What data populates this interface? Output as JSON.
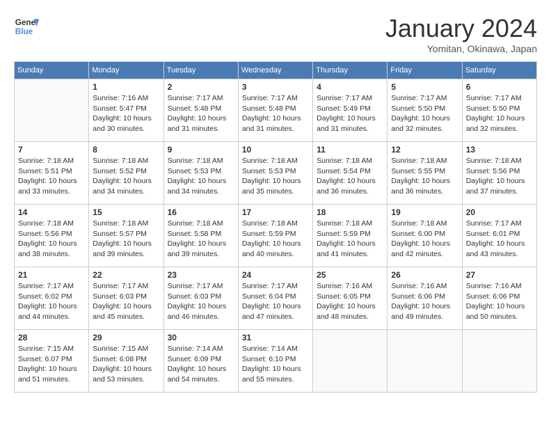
{
  "header": {
    "logo_line1": "General",
    "logo_line2": "Blue",
    "month_title": "January 2024",
    "subtitle": "Yomitan, Okinawa, Japan"
  },
  "days_of_week": [
    "Sunday",
    "Monday",
    "Tuesday",
    "Wednesday",
    "Thursday",
    "Friday",
    "Saturday"
  ],
  "weeks": [
    [
      {
        "day": null,
        "info": null
      },
      {
        "day": "1",
        "info": "Sunrise: 7:16 AM\nSunset: 5:47 PM\nDaylight: 10 hours\nand 30 minutes."
      },
      {
        "day": "2",
        "info": "Sunrise: 7:17 AM\nSunset: 5:48 PM\nDaylight: 10 hours\nand 31 minutes."
      },
      {
        "day": "3",
        "info": "Sunrise: 7:17 AM\nSunset: 5:48 PM\nDaylight: 10 hours\nand 31 minutes."
      },
      {
        "day": "4",
        "info": "Sunrise: 7:17 AM\nSunset: 5:49 PM\nDaylight: 10 hours\nand 31 minutes."
      },
      {
        "day": "5",
        "info": "Sunrise: 7:17 AM\nSunset: 5:50 PM\nDaylight: 10 hours\nand 32 minutes."
      },
      {
        "day": "6",
        "info": "Sunrise: 7:17 AM\nSunset: 5:50 PM\nDaylight: 10 hours\nand 32 minutes."
      }
    ],
    [
      {
        "day": "7",
        "info": "Sunrise: 7:18 AM\nSunset: 5:51 PM\nDaylight: 10 hours\nand 33 minutes."
      },
      {
        "day": "8",
        "info": "Sunrise: 7:18 AM\nSunset: 5:52 PM\nDaylight: 10 hours\nand 34 minutes."
      },
      {
        "day": "9",
        "info": "Sunrise: 7:18 AM\nSunset: 5:53 PM\nDaylight: 10 hours\nand 34 minutes."
      },
      {
        "day": "10",
        "info": "Sunrise: 7:18 AM\nSunset: 5:53 PM\nDaylight: 10 hours\nand 35 minutes."
      },
      {
        "day": "11",
        "info": "Sunrise: 7:18 AM\nSunset: 5:54 PM\nDaylight: 10 hours\nand 36 minutes."
      },
      {
        "day": "12",
        "info": "Sunrise: 7:18 AM\nSunset: 5:55 PM\nDaylight: 10 hours\nand 36 minutes."
      },
      {
        "day": "13",
        "info": "Sunrise: 7:18 AM\nSunset: 5:56 PM\nDaylight: 10 hours\nand 37 minutes."
      }
    ],
    [
      {
        "day": "14",
        "info": "Sunrise: 7:18 AM\nSunset: 5:56 PM\nDaylight: 10 hours\nand 38 minutes."
      },
      {
        "day": "15",
        "info": "Sunrise: 7:18 AM\nSunset: 5:57 PM\nDaylight: 10 hours\nand 39 minutes."
      },
      {
        "day": "16",
        "info": "Sunrise: 7:18 AM\nSunset: 5:58 PM\nDaylight: 10 hours\nand 39 minutes."
      },
      {
        "day": "17",
        "info": "Sunrise: 7:18 AM\nSunset: 5:59 PM\nDaylight: 10 hours\nand 40 minutes."
      },
      {
        "day": "18",
        "info": "Sunrise: 7:18 AM\nSunset: 5:59 PM\nDaylight: 10 hours\nand 41 minutes."
      },
      {
        "day": "19",
        "info": "Sunrise: 7:18 AM\nSunset: 6:00 PM\nDaylight: 10 hours\nand 42 minutes."
      },
      {
        "day": "20",
        "info": "Sunrise: 7:17 AM\nSunset: 6:01 PM\nDaylight: 10 hours\nand 43 minutes."
      }
    ],
    [
      {
        "day": "21",
        "info": "Sunrise: 7:17 AM\nSunset: 6:02 PM\nDaylight: 10 hours\nand 44 minutes."
      },
      {
        "day": "22",
        "info": "Sunrise: 7:17 AM\nSunset: 6:03 PM\nDaylight: 10 hours\nand 45 minutes."
      },
      {
        "day": "23",
        "info": "Sunrise: 7:17 AM\nSunset: 6:03 PM\nDaylight: 10 hours\nand 46 minutes."
      },
      {
        "day": "24",
        "info": "Sunrise: 7:17 AM\nSunset: 6:04 PM\nDaylight: 10 hours\nand 47 minutes."
      },
      {
        "day": "25",
        "info": "Sunrise: 7:16 AM\nSunset: 6:05 PM\nDaylight: 10 hours\nand 48 minutes."
      },
      {
        "day": "26",
        "info": "Sunrise: 7:16 AM\nSunset: 6:06 PM\nDaylight: 10 hours\nand 49 minutes."
      },
      {
        "day": "27",
        "info": "Sunrise: 7:16 AM\nSunset: 6:06 PM\nDaylight: 10 hours\nand 50 minutes."
      }
    ],
    [
      {
        "day": "28",
        "info": "Sunrise: 7:15 AM\nSunset: 6:07 PM\nDaylight: 10 hours\nand 51 minutes."
      },
      {
        "day": "29",
        "info": "Sunrise: 7:15 AM\nSunset: 6:08 PM\nDaylight: 10 hours\nand 53 minutes."
      },
      {
        "day": "30",
        "info": "Sunrise: 7:14 AM\nSunset: 6:09 PM\nDaylight: 10 hours\nand 54 minutes."
      },
      {
        "day": "31",
        "info": "Sunrise: 7:14 AM\nSunset: 6:10 PM\nDaylight: 10 hours\nand 55 minutes."
      },
      {
        "day": null,
        "info": null
      },
      {
        "day": null,
        "info": null
      },
      {
        "day": null,
        "info": null
      }
    ]
  ]
}
